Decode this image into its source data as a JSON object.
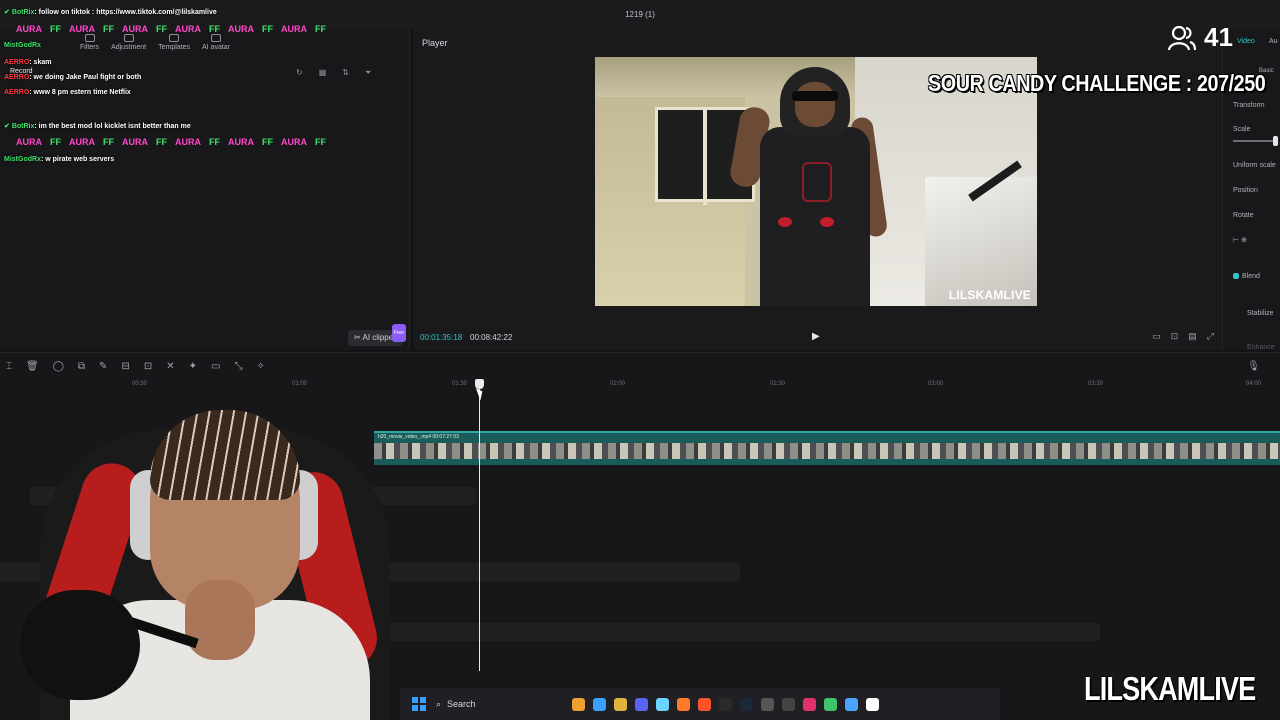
{
  "editor": {
    "project_title": "1219 (1)",
    "toolbar": [
      "Filters",
      "Adjustment",
      "Templates",
      "AI avatar"
    ],
    "record_label": "Record",
    "ai_clipper": "AI clipper",
    "ai_clipper_badge": "Free",
    "player": {
      "label": "Player",
      "current_time": "00:01:35:18",
      "duration": "00:08:42:22",
      "video_watermark": "LILSKAMLIVE"
    },
    "right_panel": {
      "tab_video": "Video",
      "tab_audio": "Au",
      "basic": "Basic",
      "transform": "Transform",
      "scale": "Scale",
      "uniform_scale": "Uniform scale",
      "position": "Position",
      "rotate": "Rotate",
      "blend": "Blend",
      "stabilize": "Stabilize",
      "enhance": "Enhance v"
    },
    "timeline": {
      "ticks": [
        "00:30",
        "01:00",
        "01:30",
        "02:00",
        "02:30",
        "03:00",
        "03:30",
        "04:00"
      ],
      "clip_label": "h20_movie_video_.mp4",
      "clip_duration": "00:07:27:03"
    }
  },
  "chat": [
    {
      "user": "BotRix",
      "user_color": "#3ee36a",
      "text": ": follow on tiktok : https://www.tiktok.com/@lilskamlive"
    },
    {
      "user": "MistGodRx",
      "user_color": "#3ee36a",
      "text": ""
    },
    {
      "user": "AERRO",
      "user_color": "#ff3b3b",
      "text": ": skam"
    },
    {
      "user": "AERRO",
      "user_color": "#ff3b3b",
      "text": ": we doing Jake Paul fight or both"
    },
    {
      "user": "AERRO",
      "user_color": "#ff3b3b",
      "text": ": www 8 pm estern time Netflix"
    },
    {
      "user": "BotRix",
      "user_color": "#3ee36a",
      "text": ": im the best mod lol kicklet isnt better than me"
    },
    {
      "user": "MistGodRx",
      "user_color": "#3ee36a",
      "text": ": w pirate web servers"
    }
  ],
  "emotes": [
    "AURA",
    "FF"
  ],
  "overlay": {
    "viewer_count": "41",
    "challenge": "SOUR CANDY CHALLENGE : 207/250",
    "streamer_watermark": "LILSKAMLIVE"
  },
  "taskbar": {
    "search_placeholder": "Search",
    "app_colors": [
      "#f0a030",
      "#3aa0ff",
      "#e2b33c",
      "#5865f2",
      "#6ad3ff",
      "#ff7a2b",
      "#fb542b",
      "#2a2a2a",
      "#1b2838",
      "#555",
      "#444",
      "#e1306c",
      "#3ec46d",
      "#4aa3ff",
      "#ffffff"
    ]
  },
  "colors": {
    "accent": "#2fc7c4",
    "timeline_clip": "#1a5c5a"
  }
}
